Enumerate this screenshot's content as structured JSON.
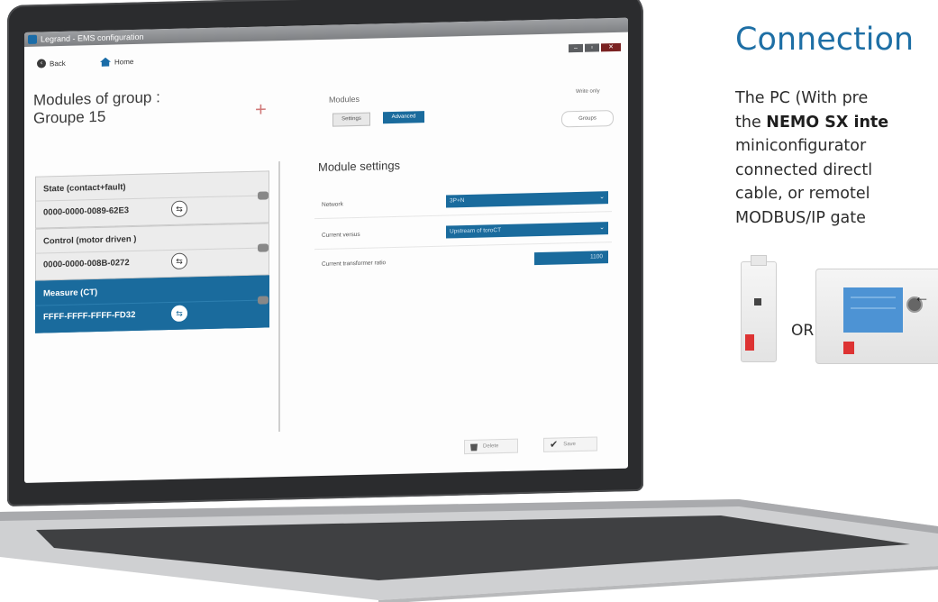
{
  "app": {
    "window_title": "Legrand - EMS configuration",
    "nav": {
      "back": "Back",
      "home": "Home"
    },
    "window_controls": [
      "–",
      "▫",
      "✕"
    ]
  },
  "left": {
    "group_title_line1": "Modules of group :",
    "group_title_line2": "Groupe 15",
    "add_symbol": "+",
    "modules": [
      {
        "type": "State (contact+fault)",
        "address": "0000-0000-0089-62E3",
        "active": false
      },
      {
        "type": "Control (motor driven )",
        "address": "0000-0000-008B-0272",
        "active": false
      },
      {
        "type": "Measure (CT)",
        "address": "FFFF-FFFF-FFFF-FD32",
        "active": true
      }
    ]
  },
  "right": {
    "page_title": "Modules",
    "mode": "Write only",
    "tabs": [
      "Settings",
      "Advanced"
    ],
    "groups_button": "Groups",
    "section_title": "Module settings",
    "fields": [
      {
        "label": "Network",
        "value": "3P+N"
      },
      {
        "label": "Current versus",
        "value": "Upstream of toroCT"
      },
      {
        "label": "Current transformer ratio",
        "value": "1100"
      }
    ],
    "delete_label": "Delete",
    "save_label": "Save"
  },
  "panel": {
    "heading": "Connection",
    "line1": "The PC (With pre",
    "line2_pre": "the ",
    "line2_bold": "NEMO SX inte",
    "line3": "miniconfigurator",
    "line4": "connected directl",
    "line5": "cable, or remotel",
    "line6": "MODBUS/IP gate",
    "or": "OR"
  },
  "colors": {
    "accent": "#1a6b9d",
    "heading": "#1e6fa5"
  }
}
